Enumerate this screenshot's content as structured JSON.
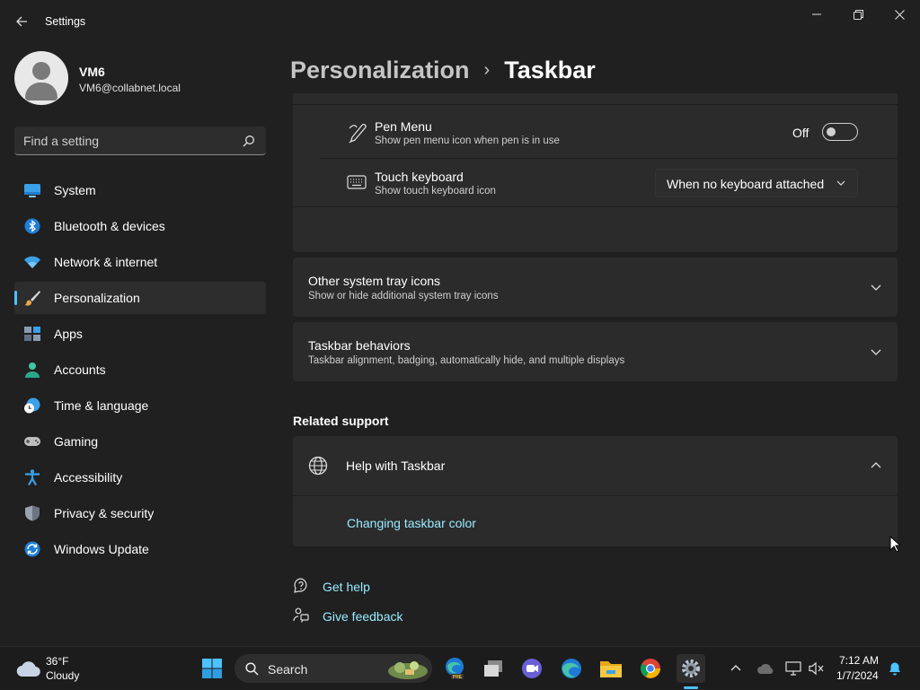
{
  "window": {
    "title": "Settings"
  },
  "profile": {
    "name": "VM6",
    "email": "VM6@collabnet.local"
  },
  "search": {
    "placeholder": "Find a setting"
  },
  "nav": {
    "items": [
      {
        "label": "System",
        "icon": "system-icon"
      },
      {
        "label": "Bluetooth & devices",
        "icon": "bluetooth-icon"
      },
      {
        "label": "Network & internet",
        "icon": "wifi-icon"
      },
      {
        "label": "Personalization",
        "icon": "brush-icon",
        "active": true
      },
      {
        "label": "Apps",
        "icon": "apps-icon"
      },
      {
        "label": "Accounts",
        "icon": "accounts-icon"
      },
      {
        "label": "Time & language",
        "icon": "time-language-icon"
      },
      {
        "label": "Gaming",
        "icon": "gaming-icon"
      },
      {
        "label": "Accessibility",
        "icon": "accessibility-icon"
      },
      {
        "label": "Privacy & security",
        "icon": "shield-icon"
      },
      {
        "label": "Windows Update",
        "icon": "update-icon"
      }
    ]
  },
  "breadcrumb": {
    "parent": "Personalization",
    "separator": "›",
    "current": "Taskbar"
  },
  "pen_menu": {
    "title": "Pen Menu",
    "subtitle": "Show pen menu icon when pen is in use",
    "state": "Off",
    "on": false
  },
  "touch_keyboard": {
    "title": "Touch keyboard",
    "subtitle": "Show touch keyboard icon",
    "selected": "When no keyboard attached"
  },
  "other_tray": {
    "title": "Other system tray icons",
    "subtitle": "Show or hide additional system tray icons",
    "expanded": false
  },
  "behaviors": {
    "title": "Taskbar behaviors",
    "subtitle": "Taskbar alignment, badging, automatically hide, and multiple displays",
    "expanded": false
  },
  "related": {
    "heading": "Related support",
    "help_title": "Help with Taskbar",
    "expanded": true,
    "link": "Changing taskbar color"
  },
  "help_links": {
    "get_help": "Get help",
    "give_feedback": "Give feedback"
  },
  "taskbar": {
    "weather_temp": "36°F",
    "weather_cond": "Cloudy",
    "search_label": "Search",
    "time": "7:12 AM",
    "date": "1/7/2024",
    "accent": "#4cc2ff"
  }
}
